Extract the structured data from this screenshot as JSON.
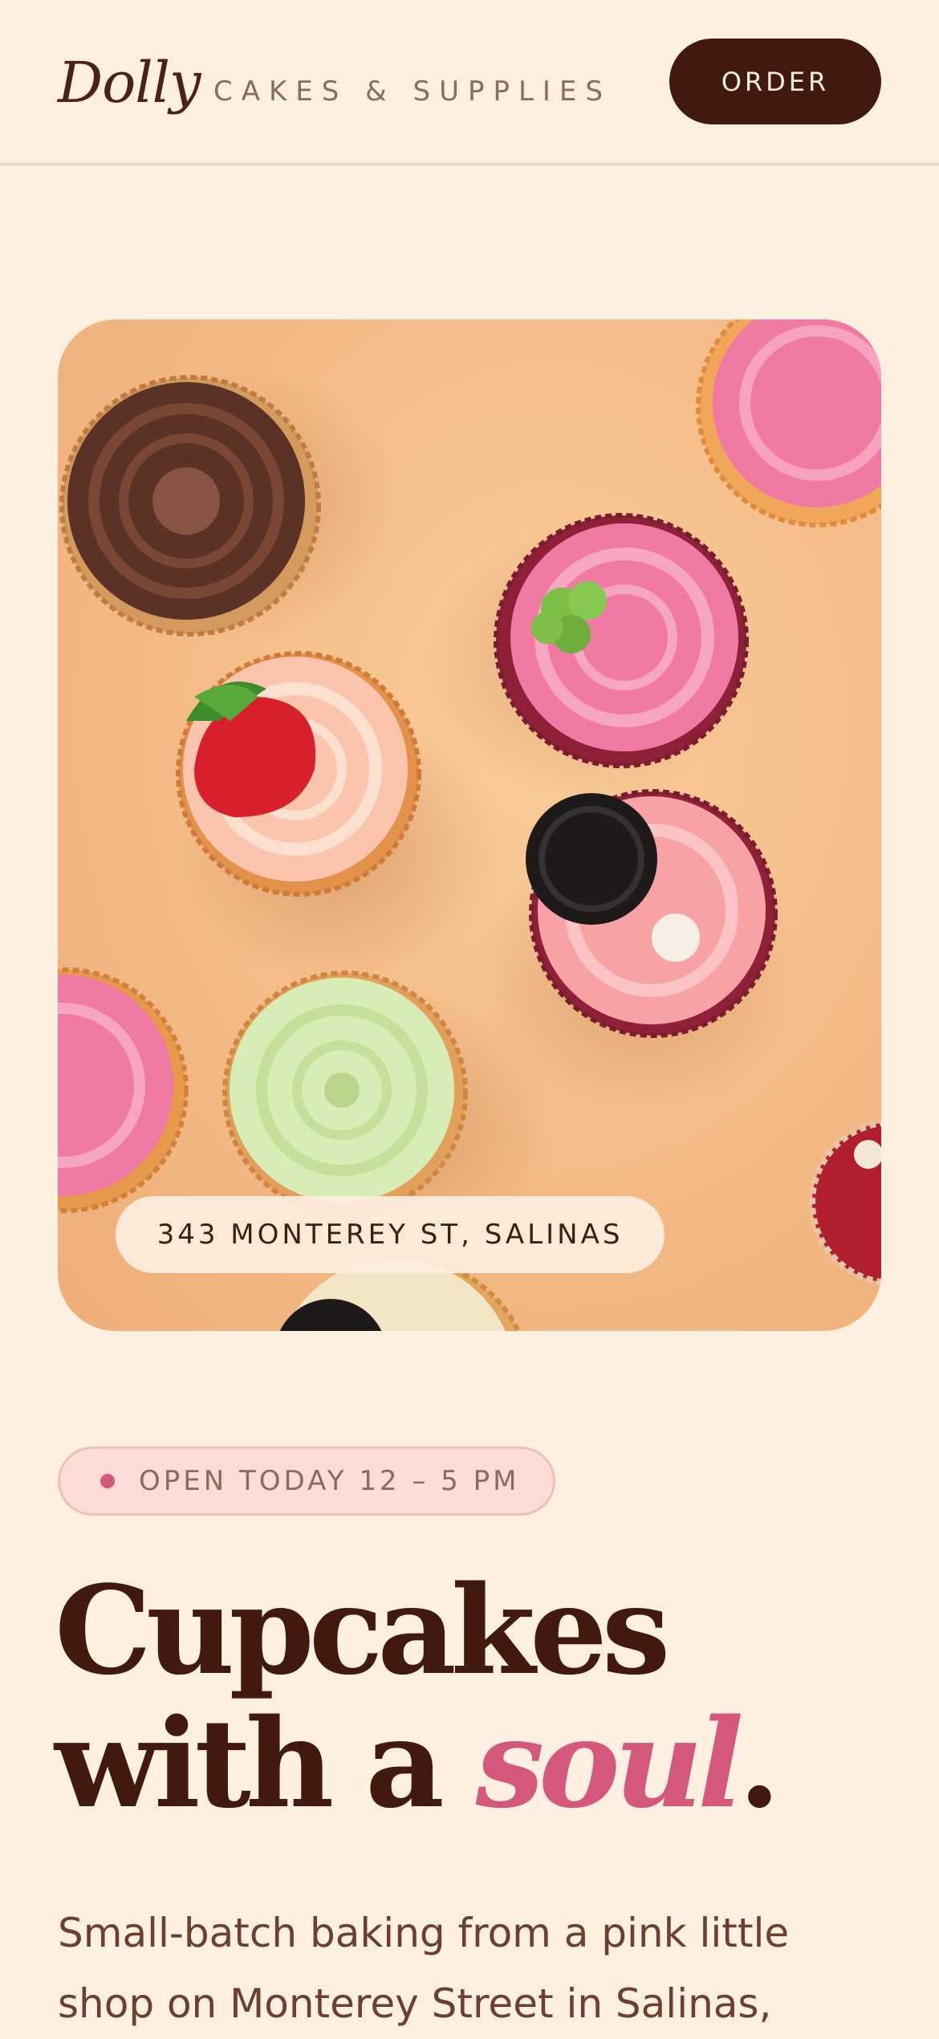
{
  "header": {
    "brand_name": "Dolly",
    "brand_tagline": "CAKES & SUPPLIES",
    "order_label": "ORDER"
  },
  "hero": {
    "image_subject": "overhead photo of frosted cupcakes on a peach background",
    "address": "343 MONTEREY ST, SALINAS"
  },
  "status": {
    "label": "OPEN TODAY 12 – 5 PM"
  },
  "headline": {
    "line1": "Cupcakes",
    "line2_prefix": "with a ",
    "accent_word": "soul",
    "suffix": "."
  },
  "intro": {
    "text": "Small-batch baking from a pink little shop on Monterey Street in Salinas,"
  },
  "colors": {
    "background": "#fdf0e1",
    "brand_dark": "#42190f",
    "accent_pink": "#d4587c",
    "status_pill": "#fbdcd6"
  }
}
